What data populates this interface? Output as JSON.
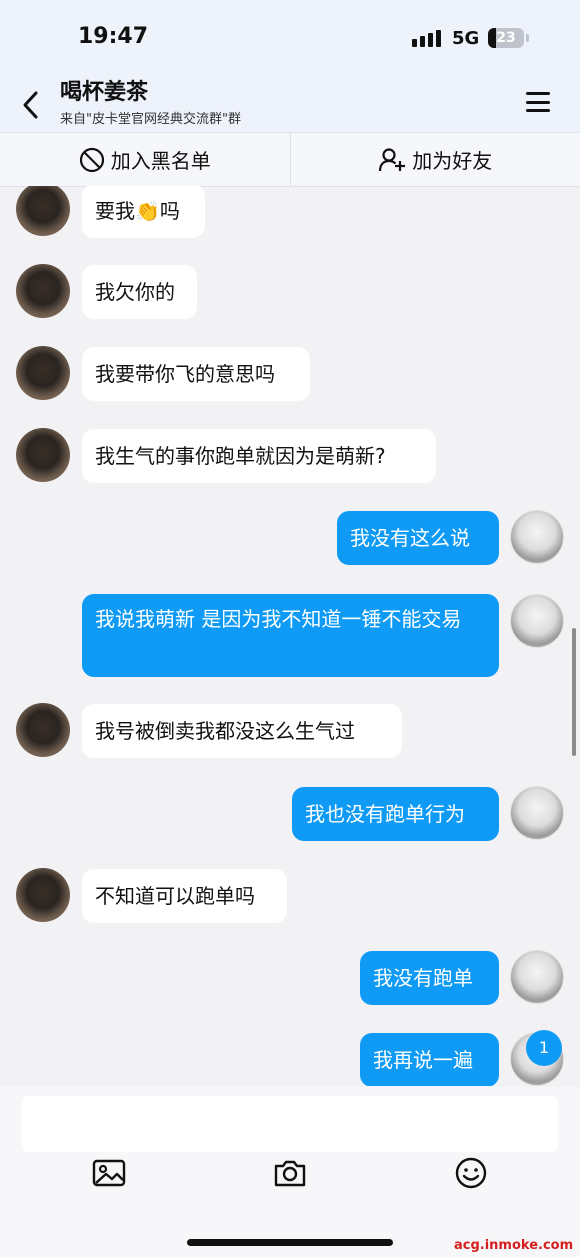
{
  "status_bar": {
    "time": "19:47",
    "network": "5G",
    "battery": "23"
  },
  "header": {
    "title": "喝杯姜茶",
    "subtitle": "来自\"皮卡堂官网经典交流群\"群"
  },
  "actions": {
    "blacklist_label": "加入黑名单",
    "add_friend_label": "加为好友"
  },
  "messages": [
    {
      "side": "in",
      "text": "要我👏吗"
    },
    {
      "side": "in",
      "text": "我欠你的"
    },
    {
      "side": "in",
      "text": "我要带你飞的意思吗"
    },
    {
      "side": "in",
      "text": "我生气的事你跑单就因为是萌新?"
    },
    {
      "side": "out",
      "text": "我没有这么说"
    },
    {
      "side": "out",
      "text": "我说我萌新 是因为我不知道一锤不能交易"
    },
    {
      "side": "in",
      "text": "我号被倒卖我都没这么生气过"
    },
    {
      "side": "out",
      "text": "我也没有跑单行为"
    },
    {
      "side": "in",
      "text": "不知道可以跑单吗"
    },
    {
      "side": "out",
      "text": "我没有跑单"
    },
    {
      "side": "out",
      "text": "我再说一遍"
    }
  ],
  "unread_badge": "1",
  "toolbar": {
    "icons": [
      "image-icon",
      "camera-icon",
      "emoji-icon"
    ]
  },
  "watermark": "acg.inmoke.com",
  "colors": {
    "outgoing_bubble": "#0f9bf5",
    "incoming_bubble": "#ffffff",
    "header_bg": "#eef2fb"
  }
}
